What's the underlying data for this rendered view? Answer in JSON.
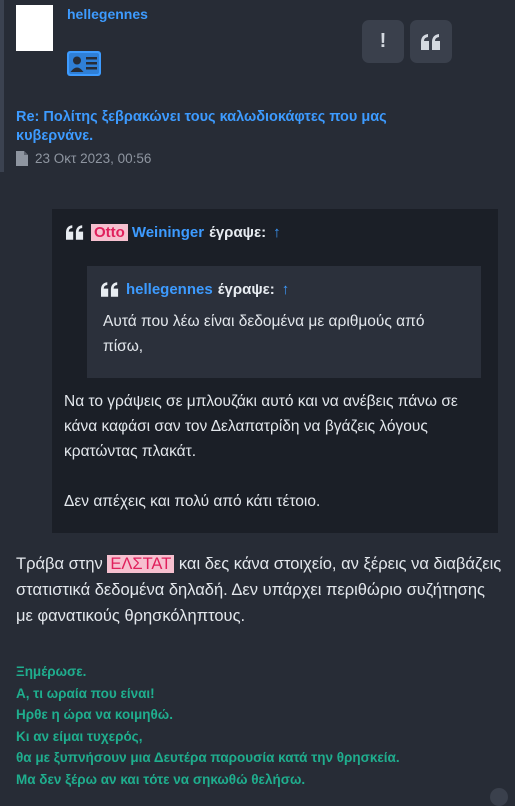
{
  "post": {
    "username": "hellegennes",
    "title": "Re: Πολίτης ξεβρακώνει τους καλωδιοκάφτες που μας κυβερνάνε.",
    "date": "23 Οκτ 2023, 00:56",
    "report_label": "!",
    "quote_icon": "quote-icon"
  },
  "quote_outer": {
    "author_tag": "Otto",
    "author_rest": "Weininger",
    "wrote": "έγραψε:",
    "arrow": "↑",
    "paragraphs": [
      "Να το γράψεις σε μπλουζάκι αυτό και να ανέβεις πάνω σε κάνα καφάσι σαν τον Δελαπατρίδη να βγάζεις λόγους κρατώντας πλακάτ.",
      "Δεν απέχεις και πολύ από κάτι τέτοιο."
    ]
  },
  "quote_inner": {
    "author": "hellegennes",
    "wrote": "έγραψε:",
    "arrow": "↑",
    "text": "Αυτά που λέω είναι δεδομένα με αριθμούς από πίσω,"
  },
  "reply": {
    "before": "Τράβα στην ",
    "tag": "ΕΛΣΤΑΤ",
    "after": " και δες κάνα στοιχείο, αν ξέρεις να διαβάζεις στατιστικά δεδομένα δηλαδή. Δεν υπάρχει περιθώριο συζήτησης με φανατικούς θρησκόληπτους."
  },
  "signature": [
    "Ξημέρωσε.",
    "Α, τι ωραία που είναι!",
    "Ηρθε η ώρα να κοιμηθώ.",
    "Κι αν είμαι τυχερός,",
    "θα με ξυπνήσουν μια Δευτέρα παρουσία κατά την θρησκεία.",
    "Μα δεν ξέρω αν και τότε να σηκωθώ θελήσω."
  ],
  "colors": {
    "background": "#272c36",
    "link": "#3d9bff",
    "signature": "#1fae8e",
    "tag_bg": "#f6c0cf",
    "tag_text": "#e0205c"
  }
}
